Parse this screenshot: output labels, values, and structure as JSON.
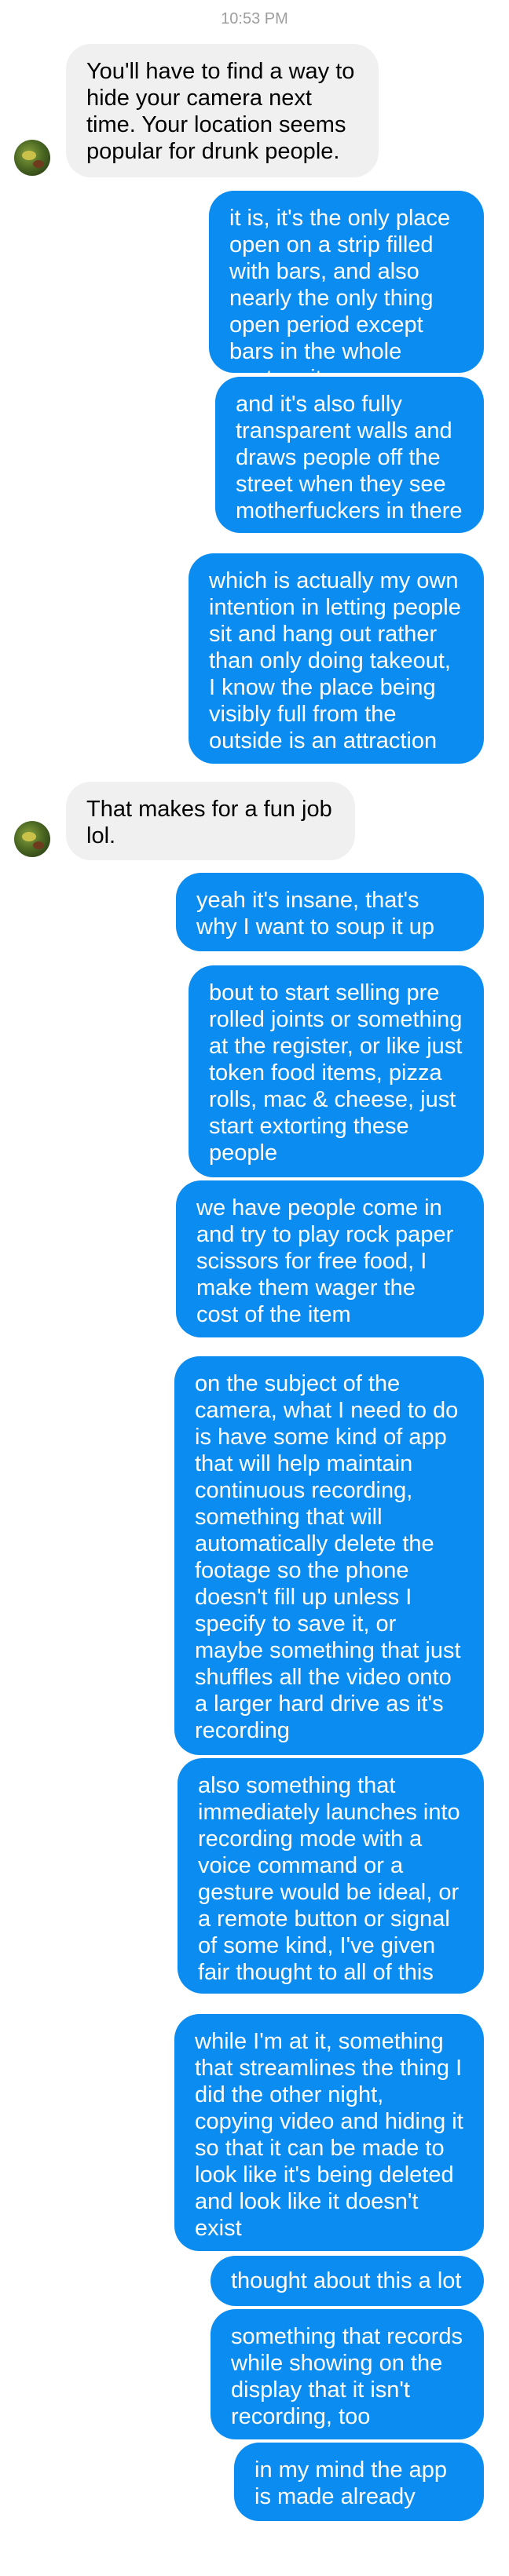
{
  "timestamp": "10:53 PM",
  "avatar_icon": "contact-avatar-icon",
  "colors": {
    "sent_bubble": "#0a8cf0",
    "received_bubble": "#f0f0f0",
    "timestamp_text": "#9e9e9e"
  },
  "messages": [
    {
      "from": "them",
      "text": "You'll have to find a way to hide your camera next time. Your location seems popular for drunk people."
    },
    {
      "from": "me",
      "text": "it is, it's the only place open on a strip filled with bars, and also nearly the only thing open period except bars in the whole center city area"
    },
    {
      "from": "me",
      "text": "and it's also fully transparent walls and draws people off the street when they see motherfuckers in there"
    },
    {
      "from": "me",
      "text": "which is actually my own intention in letting people sit and hang out rather than only doing takeout, I know the place being visibly full from the outside is an attraction"
    },
    {
      "from": "them",
      "text": "That makes for a fun job lol."
    },
    {
      "from": "me",
      "text": "yeah it's insane, that's why I want to soup it up"
    },
    {
      "from": "me",
      "text": "bout to start selling pre rolled joints or something at the register, or like just token food items, pizza rolls, mac & cheese, just start extorting these people"
    },
    {
      "from": "me",
      "text": "we have people come in and try to play rock paper scissors for free food, I make them wager the cost of the item"
    },
    {
      "from": "me",
      "text": "on the subject of the camera, what I need to do is have some kind of app that will help maintain continuous recording, something that will automatically delete the footage so the phone doesn't fill up unless I specify to save it, or maybe something that just shuffles all the video onto a larger hard drive as it's recording"
    },
    {
      "from": "me",
      "text": "also something that immediately launches into recording mode with a voice command or a gesture would be ideal, or a remote button or signal of some kind, I've given fair thought to all of this"
    },
    {
      "from": "me",
      "text": "while I'm at it, something that streamlines the thing I did the other night, copying video and hiding it so that it can be made to look like it's being deleted and look like it doesn't exist"
    },
    {
      "from": "me",
      "text": "thought about this a lot"
    },
    {
      "from": "me",
      "text": "something that records while showing on the display that it isn't recording, too"
    },
    {
      "from": "me",
      "text": "in my mind the app is made already"
    }
  ]
}
